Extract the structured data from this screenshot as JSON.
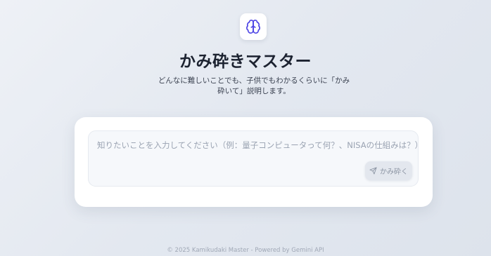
{
  "app": {
    "icon": "brain-icon",
    "title": "かみ砕きマスター",
    "subtitle": "どんなに難しいことでも、子供でもわかるくらいに「かみ砕いて」説明します。"
  },
  "input": {
    "placeholder": "知りたいことを入力してください（例：量子コンピュータって何？、NISAの仕組みは？）",
    "value": ""
  },
  "submit": {
    "label": "かみ砕く",
    "icon": "send-icon",
    "enabled": false
  },
  "footer": {
    "text": "© 2025 Kamikudaki Master - Powered by Gemini API"
  },
  "colors": {
    "accent": "#4f46e5",
    "background": "#e6ebf2",
    "card": "#ffffff"
  }
}
